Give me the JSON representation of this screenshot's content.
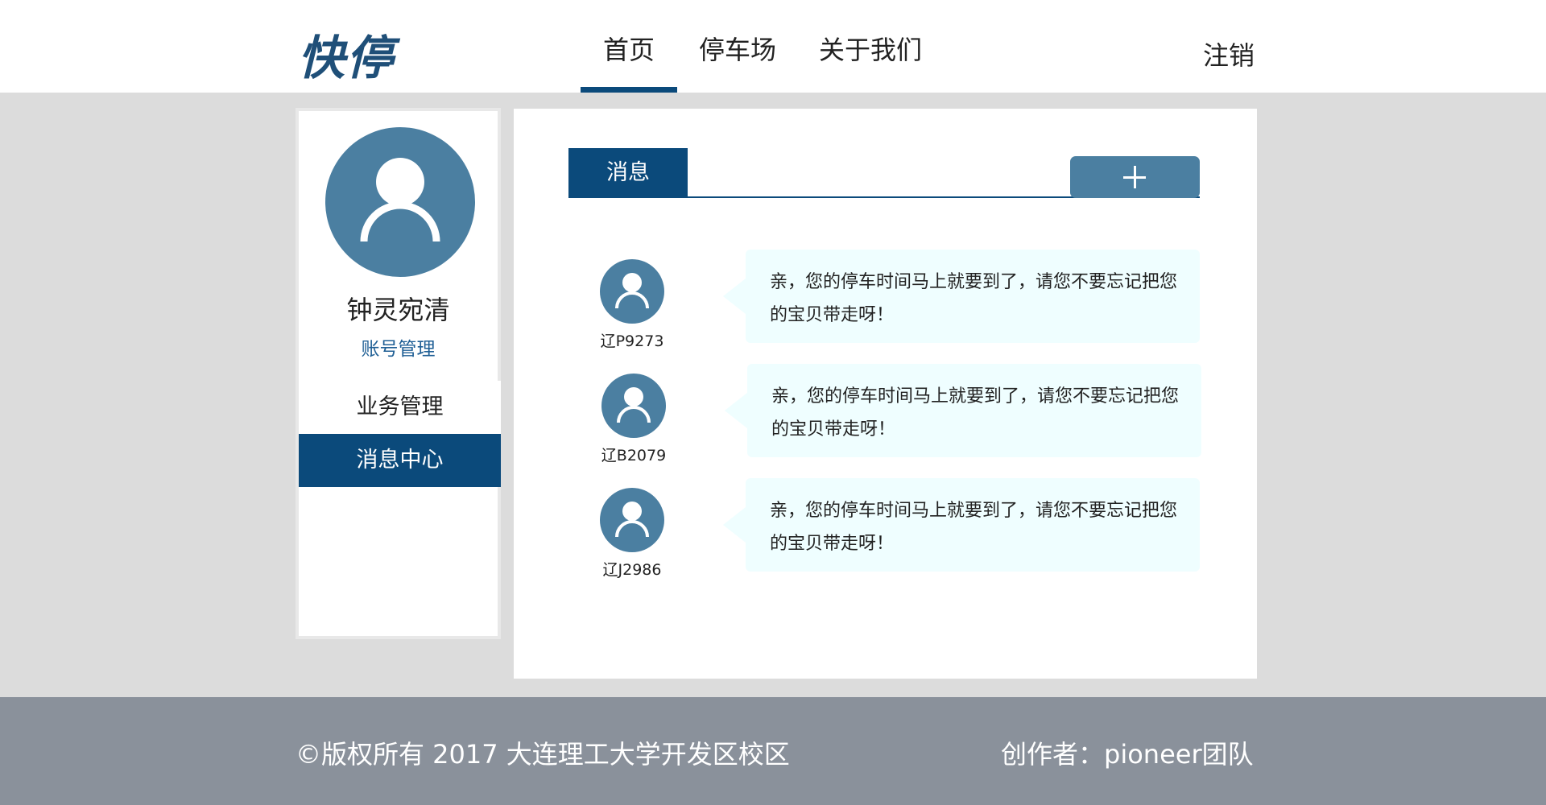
{
  "header": {
    "logo": "快停",
    "nav": [
      {
        "label": "首页",
        "active": true
      },
      {
        "label": "停车场",
        "active": false
      },
      {
        "label": "关于我们",
        "active": false
      }
    ],
    "logout_label": "注销"
  },
  "sidebar": {
    "user_name": "钟灵宛清",
    "account_link": "账号管理",
    "menu": [
      {
        "label": "业务管理",
        "active": false
      },
      {
        "label": "消息中心",
        "active": true
      }
    ]
  },
  "main": {
    "tab_label": "消息",
    "add_icon": "plus-icon",
    "messages": [
      {
        "plate": "辽P9273",
        "text": "亲，您的停车时间马上就要到了，请您不要忘记把您的宝贝带走呀！"
      },
      {
        "plate": "辽B2079",
        "text": "亲，您的停车时间马上就要到了，请您不要忘记把您的宝贝带走呀！"
      },
      {
        "plate": "辽J2986",
        "text": "亲，您的停车时间马上就要到了，请您不要忘记把您的宝贝带走呀！"
      }
    ]
  },
  "footer": {
    "copyright": "©版权所有  2017  大连理工大学开发区校区",
    "creator": "创作者：pioneer团队"
  },
  "colors": {
    "primary": "#0b4a7b",
    "avatar": "#4b7fa1",
    "bubble": "#effeff",
    "footer": "#8a919b",
    "background": "#dcdcdc"
  }
}
